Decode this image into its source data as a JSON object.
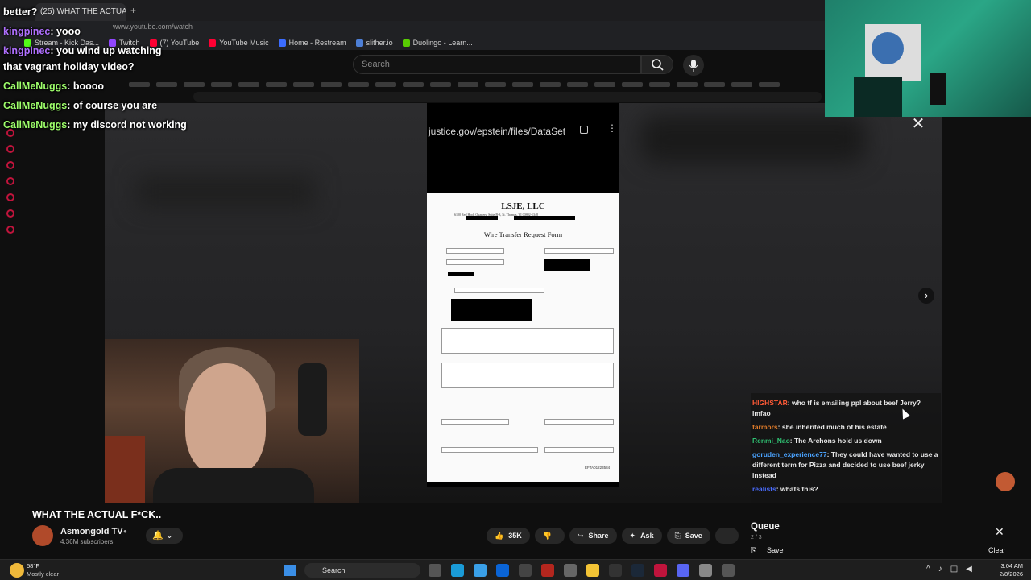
{
  "browser": {
    "tab_title": "(25) WHAT THE ACTUA",
    "url": "www.youtube.com/watch",
    "bookmarks": [
      {
        "label": "Stream - Kick Das...",
        "color": "#53fc18"
      },
      {
        "label": "Twitch",
        "color": "#9146ff"
      },
      {
        "label": "(7) YouTube",
        "color": "#ff0033"
      },
      {
        "label": "YouTube Music",
        "color": "#ff0033"
      },
      {
        "label": "Home - Restream",
        "color": "#3b6cff"
      },
      {
        "label": "slither.io",
        "color": "#4d7fd6"
      },
      {
        "label": "Duolingo - Learn...",
        "color": "#58cc02"
      }
    ]
  },
  "youtube": {
    "search_placeholder": "Search"
  },
  "overlay_chat": [
    {
      "name": "better?",
      "text": "",
      "name_color": "#ffffff"
    },
    {
      "name": "kingpinec",
      "text": ": yooo",
      "name_color": "#b070ff"
    },
    {
      "name": "kingpinec",
      "text": ": you wind up watching",
      "name_color": "#b070ff"
    },
    {
      "name": "",
      "text": "that vagrant holiday video?",
      "name_color": "#ffffff"
    },
    {
      "name": "CallMeNuggs",
      "text": ": boooo",
      "name_color": "#9eff6b"
    },
    {
      "name": "CallMeNuggs",
      "text": ": of course you are",
      "name_color": "#9eff6b"
    },
    {
      "name": "CallMeNuggs",
      "text": ": my discord not working",
      "name_color": "#9eff6b"
    }
  ],
  "phone": {
    "url": "justice.gov/epstein/files/DataSet"
  },
  "document": {
    "company": "LSJE, LLC",
    "address": "6100 Red Hook Quarters, Suite B-3, St. Thomas, VI 00802-1348",
    "form_title": "Wire Transfer Request Form",
    "footer": "EFTA01223584"
  },
  "video_chat": [
    {
      "name": "HIGHSTAR",
      "text": "who tf is emailing ppl about beef Jerry? lmfao",
      "color": "#ff5a36"
    },
    {
      "name": "farmors",
      "text": "she inherited much of his estate",
      "color": "#e07b2a"
    },
    {
      "name": "Renmi_Nao",
      "text": "The Archons hold us down",
      "color": "#2fbf71"
    },
    {
      "name": "goruden_experience77",
      "text": "They could have wanted to use a different term for Pizza and decided to use beef jerky instead",
      "color": "#4aa3ff"
    },
    {
      "name": "realists",
      "text": "whats this?",
      "color": "#4a6cff"
    }
  ],
  "video": {
    "title": "WHAT THE ACTUAL F*CK..",
    "channel": "Asmongold TV",
    "subscribers": "4.36M subscribers",
    "likes": "35K",
    "share_label": "Share",
    "ask_label": "Ask",
    "save_label": "Save"
  },
  "queue": {
    "title": "Queue",
    "count": "2 / 3",
    "save_label": "Save",
    "clear_label": "Clear"
  },
  "taskbar": {
    "temperature": "58°F",
    "condition": "Mostly clear",
    "search_label": "Search",
    "time": "3:04 AM",
    "date": "2/8/2026"
  }
}
